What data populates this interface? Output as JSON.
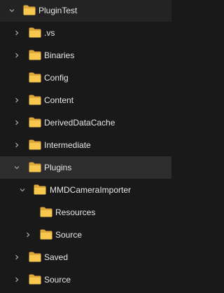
{
  "tree": {
    "root": {
      "label": "PluginTest",
      "expanded": true
    },
    "items": [
      {
        "label": ".vs",
        "state": "collapsed"
      },
      {
        "label": "Binaries",
        "state": "collapsed"
      },
      {
        "label": "Config",
        "state": "leaf"
      },
      {
        "label": "Content",
        "state": "collapsed"
      },
      {
        "label": "DerivedDataCache",
        "state": "collapsed"
      },
      {
        "label": "Intermediate",
        "state": "collapsed"
      },
      {
        "label": "Plugins",
        "state": "expanded",
        "selected": true
      },
      {
        "label": "MMDCameraImporter",
        "state": "expanded"
      },
      {
        "label": "Resources",
        "state": "leaf"
      },
      {
        "label": "Source",
        "state": "collapsed"
      },
      {
        "label": "Saved",
        "state": "collapsed"
      },
      {
        "label": "Source",
        "state": "collapsed"
      }
    ]
  },
  "colors": {
    "background": "#191919",
    "selected_row": "#2d2d2d",
    "text": "#e6e6e6",
    "chevron": "#9a9a9a",
    "folder_front": "#f8c74e",
    "folder_back": "#e0a93a"
  },
  "icons": {
    "folder": "folder-icon",
    "chevron_collapsed": "chevron-right-icon",
    "chevron_expanded": "chevron-down-icon"
  }
}
